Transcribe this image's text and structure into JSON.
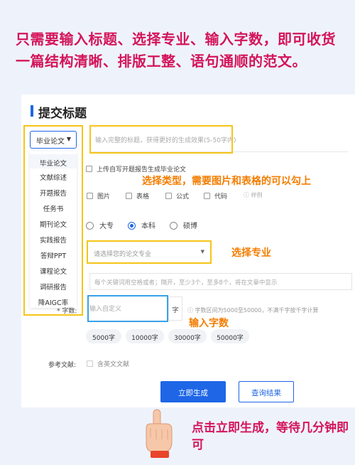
{
  "headline": "只需要输入标题、选择专业、输入字数，即可收货一篇结构清晰、排版工整、语句通顺的范文。",
  "page_title": "提交标题",
  "type_select": {
    "value": "毕业论文"
  },
  "type_menu": [
    "毕业论文",
    "文献综述",
    "开题报告",
    "任务书",
    "期刊论文",
    "实践报告",
    "答辩PPT",
    "课程论文",
    "调研报告",
    "降AIGC率"
  ],
  "title_input": {
    "placeholder": "输入完整的标题，获得更好的生成效果(5-50字内)"
  },
  "upload_option": "上传自写开题报告生成毕业论文",
  "annotation_type": "选择类型，需要图片和表格的可以勾上",
  "elements": {
    "items": [
      "图片",
      "表格",
      "公式",
      "代码"
    ],
    "sample": "样例"
  },
  "degree": {
    "options": [
      "大专",
      "本科",
      "硕博"
    ],
    "selected": "本科"
  },
  "major": {
    "placeholder": "请选择您的论文专业",
    "annotation": "选择专业"
  },
  "keywords": {
    "placeholder": "每个关键词用空格或者；隔开，至少3个，至多8个，将在文章中显示"
  },
  "word_count": {
    "label": "* 字数:",
    "placeholder": "输入自定义",
    "unit": "字",
    "hint": "字数区间为5000至50000，不满千字按千字计算",
    "annotation": "输入字数",
    "presets": [
      "5000字",
      "10000字",
      "30000字",
      "50000字"
    ]
  },
  "references": {
    "label": "参考文献:",
    "option": "含英文文献"
  },
  "buttons": {
    "generate": "立即生成",
    "query": "查询结果"
  },
  "bottom_text": "点击立即生成，等待几分钟即可",
  "colors": {
    "accent": "#1e66e6",
    "headline": "#d4145a",
    "annotation": "#f37d00",
    "highlight_box": "#f5c518"
  }
}
